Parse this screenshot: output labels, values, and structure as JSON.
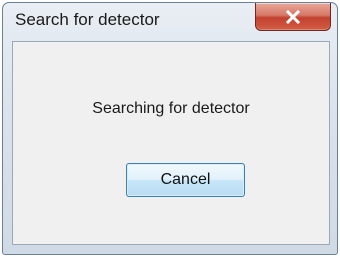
{
  "window": {
    "title": "Search for detector"
  },
  "title_bar": {
    "close_icon": "close-icon"
  },
  "dialog": {
    "message": "Searching for detector",
    "cancel_label": "Cancel"
  },
  "colors": {
    "close_button": "#c8503a",
    "cancel_button_border": "#3c7fb1"
  }
}
